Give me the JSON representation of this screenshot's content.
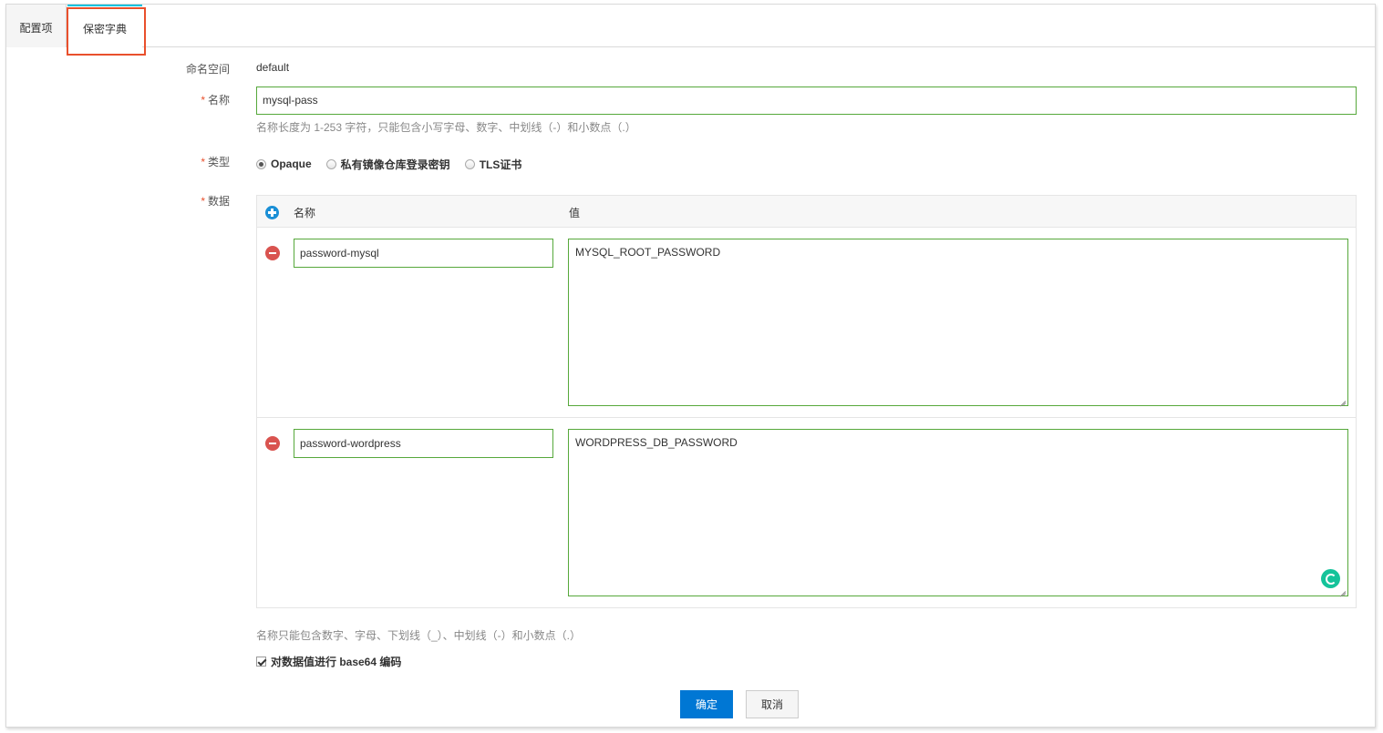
{
  "tabs": {
    "config": "配置项",
    "secret": "保密字典"
  },
  "form": {
    "namespace_label": "命名空间",
    "namespace_value": "default",
    "name_required": "*",
    "name_label": "名称",
    "name_value": "mysql-pass",
    "name_hint": "名称长度为 1-253 字符，只能包含小写字母、数字、中划线（-）和小数点（.）",
    "type_required": "*",
    "type_label": "类型",
    "type_options": [
      "Opaque",
      "私有镜像仓库登录密钥",
      "TLS证书"
    ],
    "type_selected": "Opaque",
    "data_required": "*",
    "data_label": "数据"
  },
  "data_table": {
    "col_name": "名称",
    "col_value": "值",
    "rows": [
      {
        "name": "password-mysql",
        "value": "MYSQL_ROOT_PASSWORD"
      },
      {
        "name": "password-wordpress",
        "value": "WORDPRESS_DB_PASSWORD"
      }
    ],
    "hint": "名称只能包含数字、字母、下划线（_）、中划线（-）和小数点（.）"
  },
  "base64": {
    "label": "对数据值进行 base64 编码",
    "checked": true
  },
  "buttons": {
    "confirm": "确定",
    "cancel": "取消"
  },
  "colors": {
    "primary": "#0077d4",
    "input_border": "#56a83b",
    "highlight": "#e9502c",
    "remove": "#d9534f",
    "add": "#1a8fd6"
  }
}
